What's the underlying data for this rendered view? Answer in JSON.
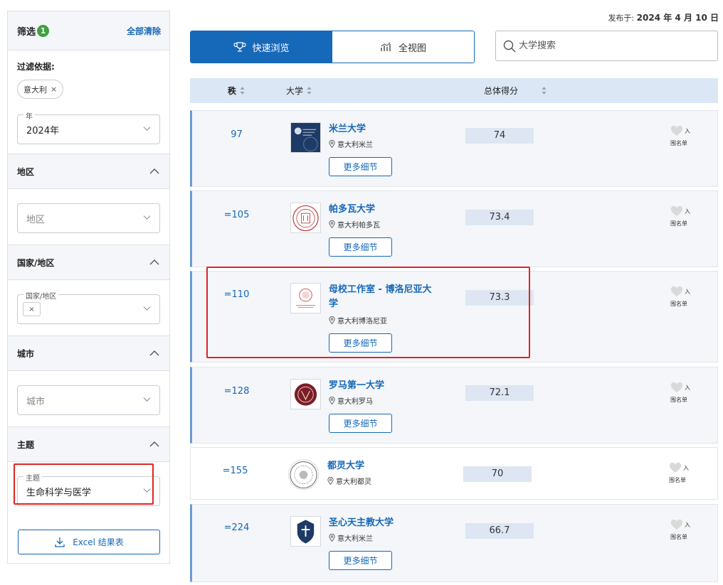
{
  "published": {
    "label": "发布于:",
    "date": "2024 年 4 月 10 日"
  },
  "sidebar": {
    "title": "筛选",
    "badge": "1",
    "clear_all": "全部清除",
    "filter_by": "过滤依据:",
    "chip": "意大利",
    "chip_remove": "×",
    "year_legend": "年",
    "year_value": "2024年",
    "sections": {
      "region": {
        "title": "地区",
        "placeholder": "地区"
      },
      "country": {
        "title": "国家/地区",
        "legend": "国家/地区",
        "chip_remove": "×"
      },
      "city": {
        "title": "城市",
        "placeholder": "城市"
      },
      "subject": {
        "title": "主题",
        "legend": "主题",
        "value": "生命科学与医学"
      }
    },
    "excel_button": "Excel 结果表"
  },
  "toolbar": {
    "quick_view": "快速浏览",
    "full_view": "全视图",
    "search_placeholder": "大学搜索"
  },
  "table": {
    "headers": {
      "rank": "秩",
      "university": "大学",
      "score": "总体得分"
    },
    "more_label": "更多细节",
    "fav_in": "入",
    "fav_list": "围名单",
    "rows": [
      {
        "rank": "97",
        "name_line1": "米兰大学",
        "name_line2": "",
        "location": "意大利米兰",
        "score": "74"
      },
      {
        "rank": "=105",
        "name_line1": "帕多瓦大学",
        "name_line2": "",
        "location": "意大利帕多瓦",
        "score": "73.4"
      },
      {
        "rank": "=110",
        "name_line1": "母校工作室 - 博洛尼亚大",
        "name_line2": "学",
        "location": "意大利博洛尼亚",
        "score": "73.3"
      },
      {
        "rank": "=128",
        "name_line1": "罗马第一大学",
        "name_line2": "",
        "location": "意大利罗马",
        "score": "72.1"
      },
      {
        "rank": "=155",
        "name_line1": "都灵大学",
        "name_line2": "",
        "location": "意大利都灵",
        "score": "70"
      },
      {
        "rank": "=224",
        "name_line1": "圣心天主教大学",
        "name_line2": "",
        "location": "意大利米兰",
        "score": "66.7"
      }
    ]
  },
  "colors": {
    "accent": "#1668b8",
    "highlight": "#e02424",
    "badge": "#3fa13f"
  }
}
